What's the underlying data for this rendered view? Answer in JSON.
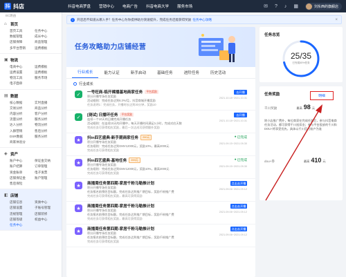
{
  "app": {
    "logo_mark": "抖",
    "logo_text": "抖店"
  },
  "topnav": {
    "items": [
      "抖音电商罗盘",
      "营销中心",
      "电商广告",
      "抖音电商大学",
      "服务市场"
    ]
  },
  "user": {
    "name": "刘东西的旗舰店"
  },
  "sidebar": {
    "top_hint": "BC路由",
    "groups": [
      {
        "title": "首页",
        "icon": "home-icon",
        "items": [
          "首页工具",
          "任务中心",
          "数据管理",
          "成长中心",
          "店铺保障",
          "商品管理",
          "多平台营销",
          "运费模板"
        ]
      },
      {
        "title": "物流",
        "icon": "truck-icon",
        "items": [
          "电商中心",
          "运费模板",
          "运费设置",
          "运费模板",
          "物流工具",
          "服务市场",
          "电子面单"
        ]
      },
      {
        "title": "数据",
        "icon": "chart-icon",
        "items": [
          "核心数据",
          "实时直播",
          "交易分析",
          "商品分析",
          "内容分析",
          "客户分析",
          "流量分析",
          "服务分析",
          "达人分析",
          "物流分析",
          "入群营销",
          "售后分析",
          "DSR数据",
          "服务分析",
          "商家体验分"
        ]
      },
      {
        "title": "资产",
        "icon": "wallet-icon",
        "items": [
          "账户中心",
          "保证金交纳",
          "账户结算",
          "订单管理",
          "资金账单",
          "电子发票",
          "店铺保证金",
          "账户管理",
          "售后保险"
        ]
      },
      {
        "title": "店铺",
        "icon": "store-icon",
        "items": [
          "店铺信息",
          "资质中心",
          "店铺设置",
          "子账号管理",
          "违规管理",
          "店铺装修",
          "店铺等级",
          "权益中心",
          "任务中心"
        ]
      }
    ],
    "active_item": "任务中心"
  },
  "notice": {
    "text": "开店后不知道从哪入手？任务中心为你提供助力快速提升，完成任务还能获得奖励",
    "link": "任务中心攻略"
  },
  "banner": {
    "title": "任务攻略助力店铺经营"
  },
  "tabs": [
    "行业成长",
    "能力认证",
    "新手启动",
    "基础任务",
    "进阶任务",
    "历史活动"
  ],
  "section": {
    "label": "行业成长"
  },
  "tasks": [
    {
      "title": "一号旺商-临开裸播基地商家任务",
      "tag": "平台奖励",
      "tag_style": "red",
      "lines": [
        "积分开播专场任务奖励",
        "活动规则：完成任务达到6.3%/月，抖音商城开播奖励",
        "任务说明1：完成任务，开播时长达到30分钟，奖励10"
      ],
      "button": "去开播",
      "date": "2021.10.18~2021.10.31",
      "icon_color": "#17b26a",
      "icon_glyph": "✓"
    },
    {
      "title": "[测试] 日播环任务",
      "tag": "平台奖励",
      "tag_style": "red",
      "lines": [
        "连续一个10天的日播完成开播任务",
        "活动规则：在连续10天的开播中，每天开播时间满足1小时，完成对应天数",
        "完成任务可获得相应奖励，最后一次达成可获得额外奖励"
      ],
      "button": "去开播",
      "date": "2021.10.18~2021.10.31",
      "icon_color": "#17b26a",
      "icon_glyph": "✓"
    },
    {
      "title": "抖in四艺盛典-新手期商家任务",
      "tag": "200元",
      "tag_style": "orange",
      "lines": [
        "积分开播专场任务奖励",
        "任务规则：完成任务达到GMV12000元，奖励10%，最高2000元",
        "完成任务可获得相应奖励"
      ],
      "status": "已完成",
      "date": "2021.09.15~2021.09.30",
      "icon_color": "#7b61ff",
      "icon_glyph": "★"
    },
    {
      "title": "抖in四艺盛典-基地任务",
      "tag": "200元",
      "tag_style": "orange",
      "lines": [
        "积分开播专场任务奖励",
        "任务规则：完成任务达到GMV12000元，奖励10%，最高2000元",
        "完成任务可获得相应奖励"
      ],
      "status": "已完成",
      "date": "2021.09.15~2021.09.30",
      "icon_color": "#7b61ff",
      "icon_glyph": "★"
    },
    {
      "title": "商播周任务第四期-家居千粉马勒推计划",
      "lines": [
        "积分开播专场任务奖励",
        "任务报名前预估目标额，完成任务达到推广期目标，奖励千粉推广费",
        "完成任务可获得相应奖励，最高可获得奖励"
      ],
      "button": "点击去开播",
      "date": "2021.09.06~2021.09.12",
      "icon_color": "#7b61ff",
      "icon_glyph": "★"
    },
    {
      "title": "商播周任务第四期-家居千粉马勒推计划",
      "lines": [
        "积分开播专场任务奖励",
        "任务报名前预估目标额，完成任务达到推广期目标，奖励千粉推广费",
        "完成任务可获得相应奖励，最高可获得奖励"
      ],
      "button": "点击去开播",
      "date": "2021.09.06~2021.09.12",
      "icon_color": "#7b61ff",
      "icon_glyph": "★"
    },
    {
      "title": "商播周任务第四期-家居千粉马勒推计划",
      "lines": [
        "积分开播专场任务奖励",
        "任务报名前预估目标额，完成任务达到推广期目标，奖励千粉推广费",
        "完成任务可获得相应奖励"
      ],
      "button": "点击去开播",
      "date": "2021.09.06~2021.09.12",
      "icon_color": "#7b61ff",
      "icon_glyph": "★"
    }
  ],
  "summary": {
    "title": "任务总览",
    "ratio": "25/35",
    "sub": "已完成65%任务",
    "progress_fraction": 0.714
  },
  "reward": {
    "title": "任务奖励",
    "detail_link": "明细",
    "row1_label": "千川奖励",
    "row1_prefix": "最高",
    "row1_value": "98",
    "row1_unit": "元",
    "note": "除小店推广费外，每位商家在完成任务后，参与抖音电商任务活动，都可获得千川抵扣金；参与平台投放的千川和DOU+将享受优先，具体以千川官方账户为准",
    "row2_label": "dou+券",
    "row2_prefix": "最高",
    "row2_value": "410",
    "row2_unit": "元"
  },
  "colors": {
    "accent": "#1966ff",
    "highlight_box": "#e02020",
    "arrow": "#c81e1e"
  }
}
